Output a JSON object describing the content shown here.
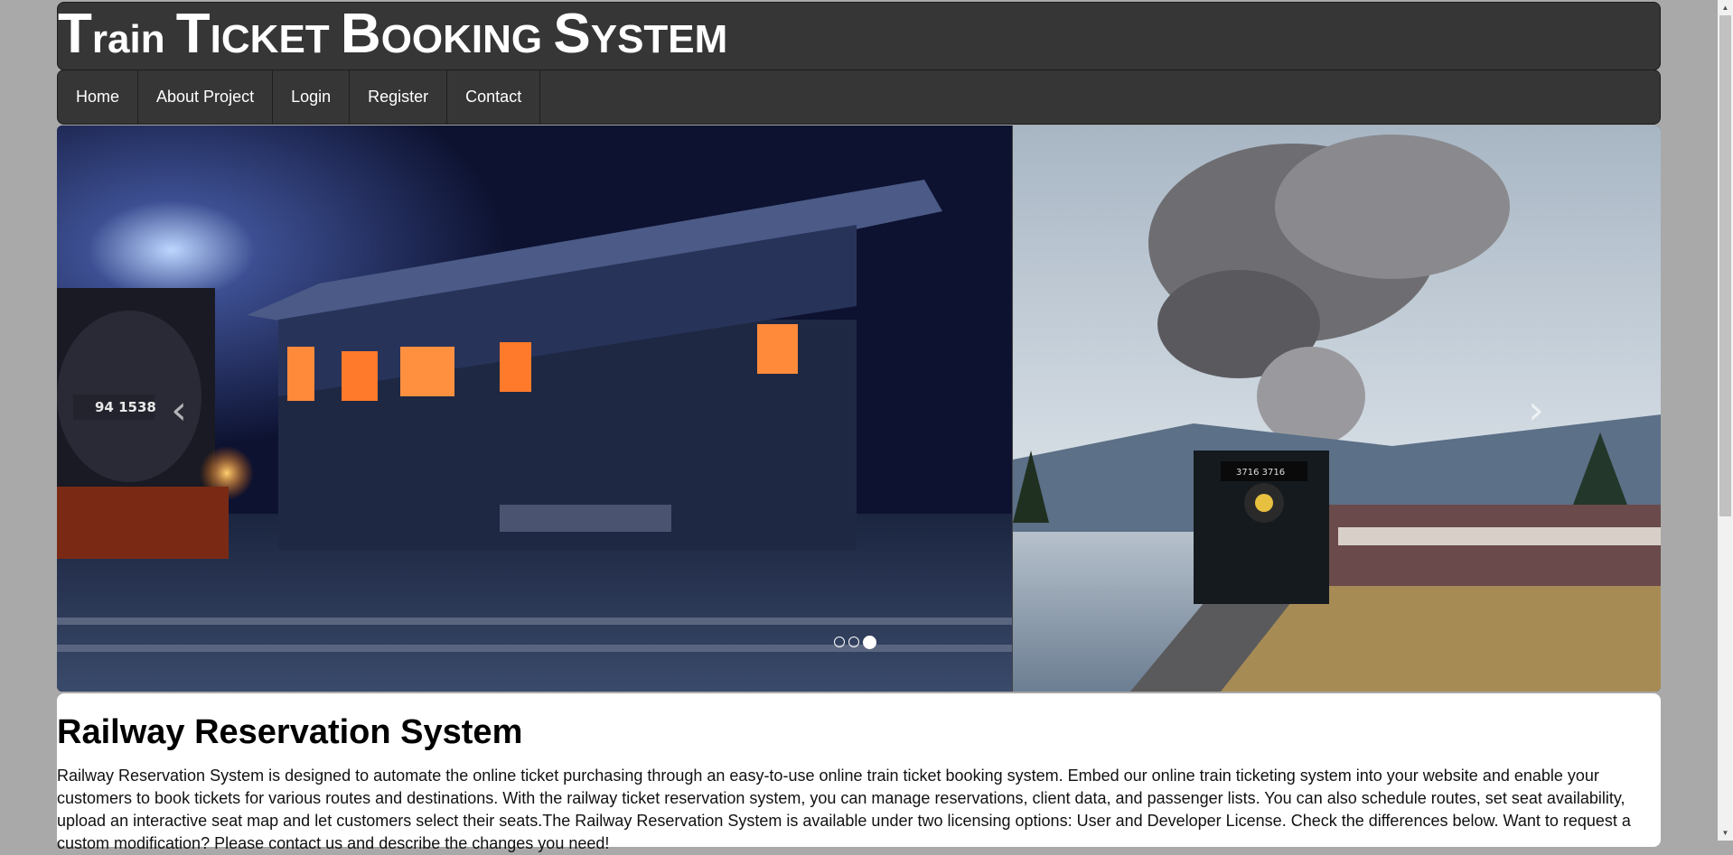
{
  "site": {
    "title_parts": [
      {
        "text": "T",
        "size": "big"
      },
      {
        "text": "rain ",
        "size": "sc"
      },
      {
        "text": "T",
        "size": "big"
      },
      {
        "text": "ICKET ",
        "size": "sc"
      },
      {
        "text": "B",
        "size": "big"
      },
      {
        "text": "OOKING ",
        "size": "sc"
      },
      {
        "text": "S",
        "size": "big"
      },
      {
        "text": "YSTEM",
        "size": "sc"
      }
    ]
  },
  "nav": {
    "items": [
      {
        "label": "Home"
      },
      {
        "label": "About Project"
      },
      {
        "label": "Login"
      },
      {
        "label": "Register"
      },
      {
        "label": "Contact"
      }
    ]
  },
  "slider": {
    "prev_glyph": "‹",
    "next_glyph": "›",
    "locomotive_number": "94 1538",
    "engine_plate": "3716 3716",
    "active_dot": 3,
    "dot_count": 3
  },
  "content": {
    "heading": "Railway Reservation System",
    "paragraph": "Railway Reservation System is designed to automate the online ticket purchasing through an easy-to-use online train ticket booking system. Embed our online train ticketing system into your website and enable your customers to book tickets for various routes and destinations. With the railway ticket reservation system, you can manage reservations, client data, and passenger lists. You can also schedule routes, set seat availability, upload an interactive seat map and let customers select their seats.The Railway Reservation System is available under two licensing options: User and Developer License. Check the differences below. Want to request a custom modification? Please contact us and describe the changes you need!"
  },
  "colors": {
    "header_bg": "#363636",
    "page_bg": "#a9a9a9",
    "content_bg": "#ffffff"
  }
}
